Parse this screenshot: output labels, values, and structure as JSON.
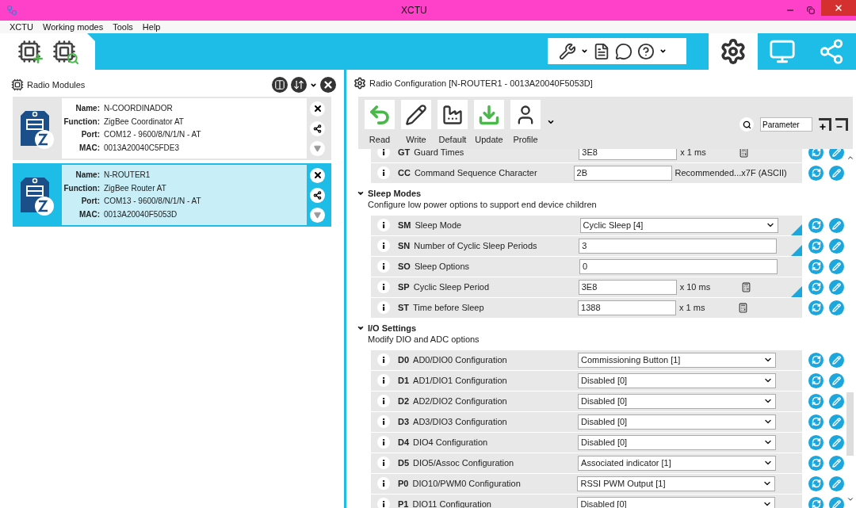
{
  "window": {
    "title": "XCTU"
  },
  "menu": [
    "XCTU",
    "Working modes",
    "Tools",
    "Help"
  ],
  "modes": [
    {
      "kind": "config",
      "selected": true
    },
    {
      "kind": "console",
      "selected": false
    },
    {
      "kind": "network",
      "selected": false
    }
  ],
  "modules_panel": {
    "title": "Radio Modules",
    "modules": [
      {
        "selected": false,
        "fields": [
          {
            "label": "Name:",
            "value": "N-COORDINADOR"
          },
          {
            "label": "Function:",
            "value": "ZigBee Coordinator AT"
          },
          {
            "label": "Port:",
            "value": "COM12 - 9600/8/N/1/N - AT"
          },
          {
            "label": "MAC:",
            "value": "0013A20040C5FDE3"
          }
        ]
      },
      {
        "selected": true,
        "fields": [
          {
            "label": "Name:",
            "value": "N-ROUTER1"
          },
          {
            "label": "Function:",
            "value": "ZigBee Router AT"
          },
          {
            "label": "Port:",
            "value": "COM13 - 9600/8/N/1/N - AT"
          },
          {
            "label": "MAC:",
            "value": "0013A20040F5053D"
          }
        ]
      }
    ]
  },
  "config_panel": {
    "title": "Radio Configuration [N-ROUTER1 - 0013A20040F5053D]",
    "actions": [
      {
        "kind": "read",
        "label": "Read"
      },
      {
        "kind": "write",
        "label": "Write"
      },
      {
        "kind": "default",
        "label": "Default"
      },
      {
        "kind": "update",
        "label": "Update"
      },
      {
        "kind": "profile",
        "label": "Profile"
      }
    ],
    "search": {
      "value": "Parameter"
    },
    "sections": [
      {
        "rows": [
          {
            "kind": "text",
            "code": "GT",
            "label": "Guard Times",
            "value": "3E8",
            "unit": "x 1 ms",
            "calculator": true,
            "changed": false
          },
          {
            "kind": "text",
            "code": "CC",
            "label": "Command Sequence Character",
            "value": "2B",
            "unit": "Recommended...x7F (ASCII)",
            "calculator": false,
            "changed": false
          }
        ]
      },
      {
        "title": "Sleep Modes",
        "description": "Configure low power options to support end device children",
        "rows": [
          {
            "kind": "select",
            "code": "SM",
            "label": "Sleep Mode",
            "value": "Cyclic Sleep [4]",
            "changed": true
          },
          {
            "kind": "text",
            "code": "SN",
            "label": "Number of Cyclic Sleep Periods",
            "value": "3",
            "calculator": false,
            "changed": true
          },
          {
            "kind": "text",
            "code": "SO",
            "label": "Sleep Options",
            "value": "0",
            "calculator": false,
            "changed": false
          },
          {
            "kind": "text",
            "code": "SP",
            "label": "Cyclic Sleep Period",
            "value": "3E8",
            "unit": "x 10 ms",
            "calculator": true,
            "changed": true
          },
          {
            "kind": "text",
            "code": "ST",
            "label": "Time before Sleep",
            "value": "1388",
            "unit": "x 1 ms",
            "calculator": true,
            "changed": false
          }
        ]
      },
      {
        "title": "I/O Settings",
        "description": "Modify DIO and ADC options",
        "rows": [
          {
            "kind": "select",
            "code": "D0",
            "label": "AD0/DIO0 Configuration",
            "value": "Commissioning Button [1]",
            "changed": false
          },
          {
            "kind": "select",
            "code": "D1",
            "label": "AD1/DIO1 Configuration",
            "value": "Disabled [0]",
            "changed": false
          },
          {
            "kind": "select",
            "code": "D2",
            "label": "AD2/DIO2 Configuration",
            "value": "Disabled [0]",
            "changed": false
          },
          {
            "kind": "select",
            "code": "D3",
            "label": "AD3/DIO3 Configuration",
            "value": "Disabled [0]",
            "changed": false
          },
          {
            "kind": "select",
            "code": "D4",
            "label": "DIO4 Configuration",
            "value": "Disabled [0]",
            "changed": false
          },
          {
            "kind": "select",
            "code": "D5",
            "label": "DIO5/Assoc Configuration",
            "value": "Associated indicator [1]",
            "changed": false
          },
          {
            "kind": "select",
            "code": "P0",
            "label": "DIO10/PWM0 Configuration",
            "value": "RSSI PWM Output [1]",
            "changed": false
          },
          {
            "kind": "select",
            "code": "P1",
            "label": "DIO11 Configuration",
            "value": "Disabled [0]",
            "changed": false
          }
        ]
      }
    ]
  }
}
